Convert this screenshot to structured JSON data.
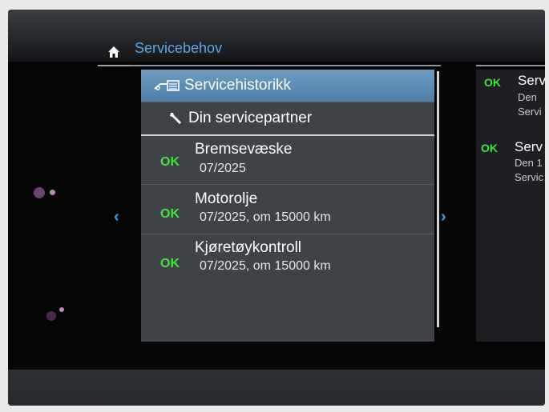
{
  "header": {
    "title": "Servicebehov"
  },
  "menu": {
    "selected_label": "Servicehistorikk",
    "partner_label": "Din servicepartner"
  },
  "items": [
    {
      "status": "OK",
      "title": "Bremsevæske",
      "subtitle": "07/2025"
    },
    {
      "status": "OK",
      "title": "Motorolje",
      "subtitle": "07/2025, om 15000 km"
    },
    {
      "status": "OK",
      "title": "Kjøretøykontroll",
      "subtitle": "07/2025, om 15000 km"
    }
  ],
  "nav": {
    "left_arrow": "‹",
    "right_arrow": "›"
  },
  "right_panel": [
    {
      "status": "OK",
      "title": "Serv",
      "line1": "Den",
      "line2": "Servi"
    },
    {
      "status": "OK",
      "title": "Serv",
      "line1": "Den 1",
      "line2": "Servic"
    }
  ],
  "colors": {
    "accent_blue": "#58a8e8",
    "ok_green": "#3ee63a",
    "highlight": "#5f8fb6",
    "panel": "#3f4246"
  },
  "icons": {
    "home": "home-icon",
    "service_history": "car-service-icon",
    "partner": "wrench-icon"
  }
}
